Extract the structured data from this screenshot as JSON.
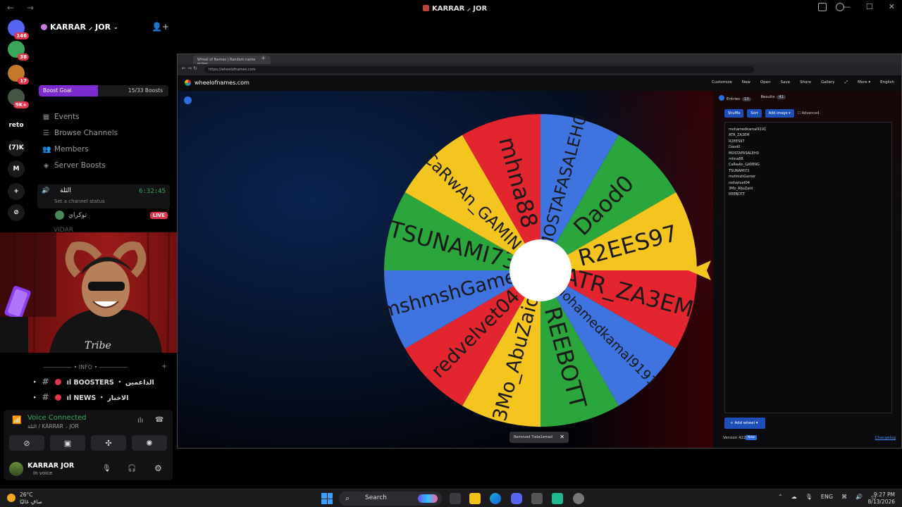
{
  "window": {
    "title": "KARRAR ⸝ JOR",
    "back": "←",
    "forward": "→"
  },
  "rail": {
    "servers": [
      {
        "label": "",
        "badge": "146",
        "color": "#5865f2"
      },
      {
        "label": "",
        "badge": "38",
        "color": "#3ba55c"
      },
      {
        "label": "",
        "badge": "17",
        "color": "#c47a2a"
      },
      {
        "label": "",
        "badge": "9K+",
        "color": "#445544"
      },
      {
        "label": "reto",
        "badge": "",
        "color": "#000000"
      },
      {
        "label": "(7)K",
        "badge": "",
        "color": "#1a1a1a"
      },
      {
        "label": "M",
        "badge": "",
        "color": "#1a1a1a"
      },
      {
        "label": "+",
        "badge": "",
        "color": "#1a1a1a"
      },
      {
        "label": "⊘",
        "badge": "",
        "color": "#1a1a1a"
      }
    ]
  },
  "sidebar": {
    "guild_name": "KARRAR ⸝ JOR",
    "boost": {
      "label": "Boost Goal",
      "count": "15/33 Boosts",
      "progress": 0.4545
    },
    "items": [
      {
        "label": "Events",
        "icon": "calendar-icon"
      },
      {
        "label": "Browse Channels",
        "icon": "browse-icon"
      },
      {
        "label": "Members",
        "icon": "members-icon"
      },
      {
        "label": "Server Boosts",
        "icon": "boost-icon"
      }
    ],
    "voice_channel": {
      "name": "الثلة",
      "time": "6:32:45",
      "status": "Set a channel status"
    },
    "voice_users": [
      {
        "name": "توكراي",
        "live": "LIVE"
      },
      {
        "name": "VIDAR"
      }
    ],
    "info_header": "――――― • INFO • ―――――",
    "channels": [
      {
        "label": "ıl BOOSTERS ・ الداعمين"
      },
      {
        "label": "ıl NEWS ・ الاخبار"
      }
    ]
  },
  "voice_panel": {
    "title": "Voice Connected",
    "subtitle": "الثلة / KARRAR ⸝ JOR",
    "user": "KARRAR JOR",
    "user_status": "In voice"
  },
  "browser": {
    "tab_title": "Wheel of Names | Random name picker",
    "url": "https://wheelofnames.com",
    "site_name": "wheelofnames.com",
    "menu": [
      "Customize",
      "New",
      "Open",
      "Save",
      "Share",
      "Gallery",
      "More ▾",
      "English"
    ],
    "panel": {
      "tab_entries": "Entries",
      "entries_count": "13",
      "tab_results": "Results",
      "results_count": "41",
      "tools": [
        "Shuffle",
        "Sort",
        "Add image ▾"
      ],
      "advanced": "Advanced",
      "entries": [
        "mohamedkamal9191",
        "ATR_ZA3EM",
        "R2EES97",
        "Daod0",
        "MOSTAFASALEH0",
        "mhna88",
        "CaRwAn_GAMING",
        "TSUNAMI73",
        "mshmshGamer",
        "redvelvet04",
        "3Mo_AbuZaid",
        "REEBOTT"
      ],
      "add_wheel": "Add wheel",
      "version": "Version 422",
      "new_badge": "New",
      "changelog": "Changelog"
    },
    "toast": "Removed 7oda1emad",
    "toast_close": "✕"
  },
  "wheel": {
    "segments": [
      {
        "label": "MOSTAFASALEH0",
        "color": "#3f73e0"
      },
      {
        "label": "Daod0",
        "color": "#2aa63c"
      },
      {
        "label": "R2EES97",
        "color": "#f4c51e"
      },
      {
        "label": "ATR_ZA3EM",
        "color": "#e3252f"
      },
      {
        "label": "mohamedkamal9191",
        "color": "#3f73e0"
      },
      {
        "label": "REEBOTT",
        "color": "#2aa63c"
      },
      {
        "label": "3Mo_AbuZaid",
        "color": "#f4c51e"
      },
      {
        "label": "redvelvet04",
        "color": "#e3252f"
      },
      {
        "label": "mshmshGamer",
        "color": "#3f73e0"
      },
      {
        "label": "TSUNAMI73",
        "color": "#2aa63c"
      },
      {
        "label": "CaRwAn_GAMING",
        "color": "#f4c51e"
      },
      {
        "label": "mhna88",
        "color": "#e3252f"
      }
    ],
    "pointer_color": "#f4c51e"
  },
  "taskbar": {
    "weather_temp": "26°C",
    "weather_desc": "صافٍ غالبًا",
    "search": "Search",
    "language": "ENG",
    "time": "9:27 PM",
    "date": "8/13/2026"
  }
}
